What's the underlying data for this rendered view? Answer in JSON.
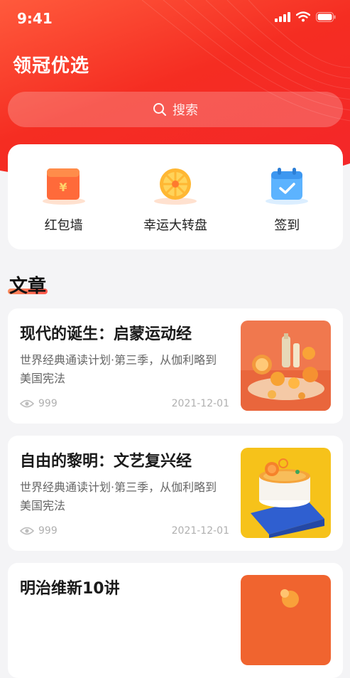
{
  "status": {
    "time": "9:41"
  },
  "header": {
    "title": "领冠优选",
    "search_placeholder": "搜索"
  },
  "quick_actions": [
    {
      "label": "红包墙",
      "icon": "red-envelope-icon"
    },
    {
      "label": "幸运大转盘",
      "icon": "lucky-wheel-icon"
    },
    {
      "label": "签到",
      "icon": "calendar-check-icon"
    }
  ],
  "section": {
    "title": "文章"
  },
  "articles": [
    {
      "title": "现代的诞生：启蒙运动经",
      "desc": "世界经典通读计划·第三季，从伽利略到美国宪法",
      "views": "999",
      "date": "2021-12-01"
    },
    {
      "title": "自由的黎明：文艺复兴经",
      "desc": "世界经典通读计划·第三季，从伽利略到美国宪法",
      "views": "999",
      "date": "2021-12-01"
    },
    {
      "title": "明治维新10讲"
    }
  ],
  "colors": {
    "brand": "#f4262a",
    "accent": "#ff7a45"
  }
}
